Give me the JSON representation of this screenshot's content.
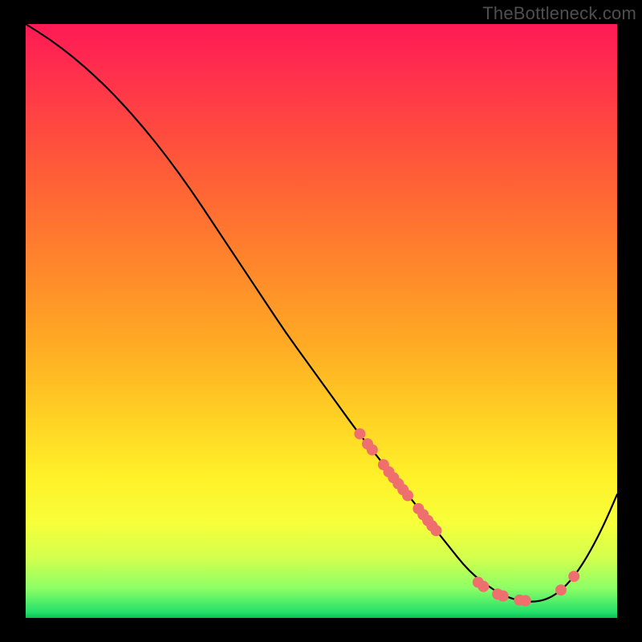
{
  "watermark": "TheBottleneck.com",
  "colors": {
    "background": "#000000",
    "curve_stroke": "#000000",
    "dot_fill": "#ef6f6f",
    "gradient_top": "#ff1a55",
    "gradient_bottom": "#0cbf56"
  },
  "chart_data": {
    "type": "line",
    "title": "",
    "xlabel": "",
    "ylabel": "",
    "xlim": [
      0,
      100
    ],
    "ylim": [
      0,
      100
    ],
    "grid": false,
    "legend": false,
    "series": [
      {
        "name": "bottleneck-curve",
        "x": [
          0,
          4,
          8,
          12,
          16,
          20,
          24,
          28,
          32,
          36,
          40,
          44,
          48,
          52,
          56,
          58,
          60,
          62,
          64,
          66,
          68,
          70,
          72,
          74,
          76,
          78,
          80,
          82,
          84,
          86,
          88,
          90,
          92,
          94,
          96,
          98,
          100
        ],
        "y": [
          100,
          97.5,
          94.5,
          91,
          87,
          82.5,
          77.5,
          72,
          66,
          60,
          54,
          48,
          42.5,
          37,
          31.5,
          29,
          26.5,
          24,
          21.5,
          19,
          16.5,
          14,
          11.5,
          9,
          7,
          5.5,
          4.2,
          3.3,
          2.8,
          2.7,
          3.1,
          4.2,
          6.1,
          8.8,
          12.2,
          16.2,
          20.8
        ]
      }
    ],
    "points": [
      {
        "name": "cluster-a-1",
        "x": 56.5,
        "y": 31.0
      },
      {
        "name": "cluster-a-2",
        "x": 57.8,
        "y": 29.3
      },
      {
        "name": "cluster-a-3",
        "x": 58.6,
        "y": 28.3
      },
      {
        "name": "cluster-b-1",
        "x": 60.5,
        "y": 25.8
      },
      {
        "name": "cluster-b-2",
        "x": 61.4,
        "y": 24.6
      },
      {
        "name": "cluster-b-3",
        "x": 62.2,
        "y": 23.6
      },
      {
        "name": "cluster-b-4",
        "x": 63.0,
        "y": 22.6
      },
      {
        "name": "cluster-b-5",
        "x": 63.8,
        "y": 21.6
      },
      {
        "name": "cluster-b-6",
        "x": 64.6,
        "y": 20.6
      },
      {
        "name": "cluster-c-1",
        "x": 66.4,
        "y": 18.4
      },
      {
        "name": "cluster-c-2",
        "x": 67.2,
        "y": 17.4
      },
      {
        "name": "cluster-c-3",
        "x": 68.0,
        "y": 16.4
      },
      {
        "name": "cluster-c-4",
        "x": 68.7,
        "y": 15.5
      },
      {
        "name": "cluster-c-5",
        "x": 69.4,
        "y": 14.7
      },
      {
        "name": "valley-1",
        "x": 76.5,
        "y": 6.0
      },
      {
        "name": "valley-2",
        "x": 77.4,
        "y": 5.3
      },
      {
        "name": "valley-3",
        "x": 79.8,
        "y": 4.0
      },
      {
        "name": "valley-4",
        "x": 80.7,
        "y": 3.7
      },
      {
        "name": "valley-5",
        "x": 83.5,
        "y": 3.0
      },
      {
        "name": "valley-6",
        "x": 84.5,
        "y": 2.9
      },
      {
        "name": "rise-1",
        "x": 90.5,
        "y": 4.7
      },
      {
        "name": "rise-2",
        "x": 92.7,
        "y": 7.0
      }
    ],
    "point_radius_pct": 0.95
  }
}
